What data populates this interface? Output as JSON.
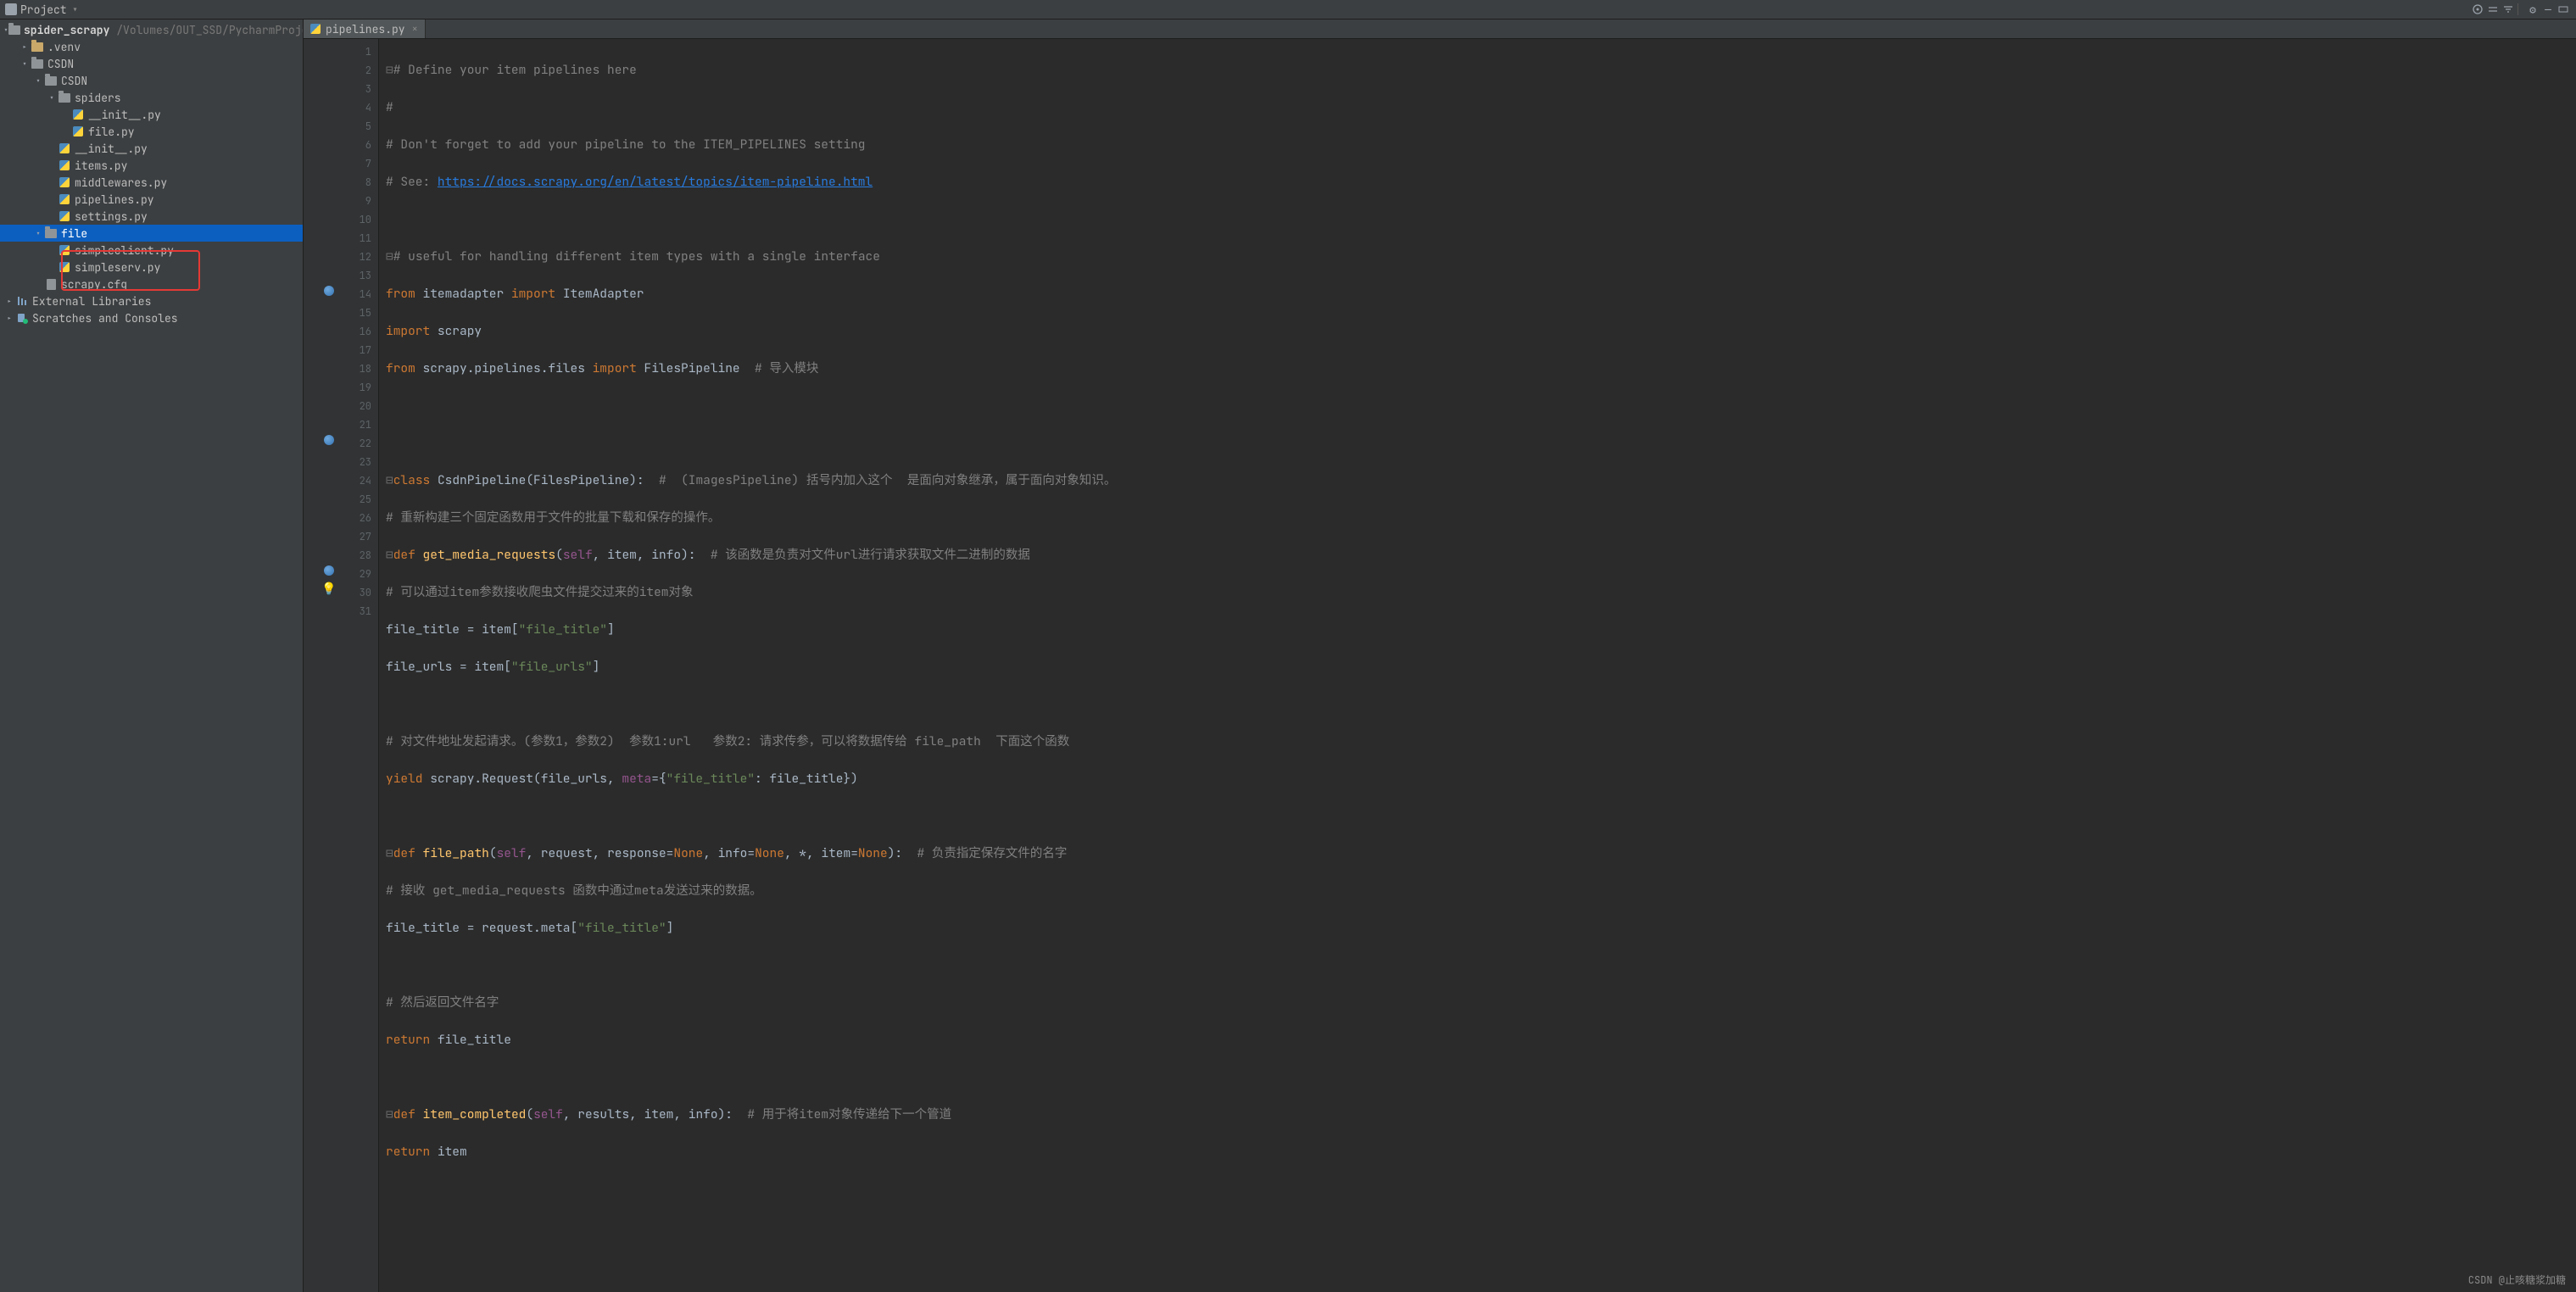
{
  "toolbar": {
    "title": "Project"
  },
  "tab": {
    "filename": "pipelines.py"
  },
  "tree": {
    "root": {
      "name": "spider_scrapy",
      "path": "/Volumes/OUT_SSD/PycharmProje"
    },
    "items": [
      {
        "lvl": 1,
        "chev": ">",
        "ico": "dir-open",
        "label": ".venv"
      },
      {
        "lvl": 1,
        "chev": "v",
        "ico": "dir",
        "label": "CSDN"
      },
      {
        "lvl": 2,
        "chev": "v",
        "ico": "dir",
        "label": "CSDN"
      },
      {
        "lvl": 3,
        "chev": "v",
        "ico": "dir",
        "label": "spiders"
      },
      {
        "lvl": 4,
        "chev": "",
        "ico": "py",
        "label": "__init__.py"
      },
      {
        "lvl": 4,
        "chev": "",
        "ico": "py",
        "label": "file.py"
      },
      {
        "lvl": 3,
        "chev": "",
        "ico": "py",
        "label": "__init__.py"
      },
      {
        "lvl": 3,
        "chev": "",
        "ico": "py",
        "label": "items.py"
      },
      {
        "lvl": 3,
        "chev": "",
        "ico": "py",
        "label": "middlewares.py"
      },
      {
        "lvl": 3,
        "chev": "",
        "ico": "py",
        "label": "pipelines.py"
      },
      {
        "lvl": 3,
        "chev": "",
        "ico": "py",
        "label": "settings.py"
      },
      {
        "lvl": 2,
        "chev": "v",
        "ico": "dir",
        "label": "file",
        "sel": true
      },
      {
        "lvl": 3,
        "chev": "",
        "ico": "py",
        "label": "simpleclient.py"
      },
      {
        "lvl": 3,
        "chev": "",
        "ico": "py",
        "label": "simpleserv.py"
      },
      {
        "lvl": 2,
        "chev": "",
        "ico": "file",
        "label": "scrapy.cfg"
      }
    ],
    "extlib": "External Libraries",
    "scratches": "Scratches and Consoles"
  },
  "code": {
    "l1a": "# Define your item pipelines here",
    "l2": "#",
    "l3": "# Don't forget to add your pipeline to the ITEM_PIPELINES setting",
    "l4a": "# See: ",
    "l4b": "https://docs.scrapy.org/en/latest/topics/item-pipeline.html",
    "l6": "# useful for handling different item types with a single interface",
    "l7a": "from ",
    "l7b": "itemadapter ",
    "l7c": "import ",
    "l7d": "ItemAdapter",
    "l8a": "import ",
    "l8b": "scrapy",
    "l9a": "from ",
    "l9b": "scrapy.pipelines.files ",
    "l9c": "import ",
    "l9d": "FilesPipeline  ",
    "l9e": "# 导入模块",
    "l12a": "class ",
    "l12b": "CsdnPipeline",
    "l12c": "(FilesPipeline):  ",
    "l12d": "#  (ImagesPipeline) 括号内加入这个  是面向对象继承，属于面向对象知识。",
    "l13": "# 重新构建三个固定函数用于文件的批量下载和保存的操作。",
    "l14a": "def ",
    "l14b": "get_media_requests",
    "l14c": "(",
    "l14d": "self",
    "l14e": ", item, info):  ",
    "l14f": "# 该函数是负责对文件url进行请求获取文件二进制的数据",
    "l15": "# 可以通过item参数接收爬虫文件提交过来的item对象",
    "l16a": "file_title = item[",
    "l16b": "\"file_title\"",
    "l16c": "]",
    "l17a": "file_urls = item[",
    "l17b": "\"file_urls\"",
    "l17c": "]",
    "l19": "# 对文件地址发起请求。(参数1，参数2)  参数1:url   参数2: 请求传参，可以将数据传给 file_path  下面这个函数",
    "l20a": "yield ",
    "l20b": "scrapy.Request(file_urls, ",
    "l20c": "meta",
    "l20d": "={",
    "l20e": "\"file_title\"",
    "l20f": ": file_title})",
    "l22a": "def ",
    "l22b": "file_path",
    "l22c": "(",
    "l22d": "self",
    "l22e": ", request, response=",
    "l22f": "None",
    "l22g": ", info=",
    "l22h": "None",
    "l22i": ", *, item=",
    "l22j": "None",
    "l22k": "):  ",
    "l22l": "# 负责指定保存文件的名字",
    "l23": "# 接收 get_media_requests 函数中通过meta发送过来的数据。",
    "l24a": "file_title = request.meta[",
    "l24b": "\"file_title\"",
    "l24c": "]",
    "l26": "# 然后返回文件名字",
    "l27a": "return ",
    "l27b": "file_title",
    "l29a": "def ",
    "l29b": "item_completed",
    "l29c": "(",
    "l29d": "self",
    "l29e": ", results, item, info):  ",
    "l29f": "# 用于将item对象传递给下一个管道",
    "l30a": "return ",
    "l30b": "item"
  },
  "linenumbers": [
    "1",
    "2",
    "3",
    "4",
    "5",
    "6",
    "7",
    "8",
    "9",
    "10",
    "11",
    "12",
    "13",
    "14",
    "15",
    "16",
    "17",
    "18",
    "19",
    "20",
    "21",
    "22",
    "23",
    "24",
    "25",
    "26",
    "27",
    "28",
    "29",
    "30",
    "31"
  ],
  "watermark": "CSDN @止咳糖浆加糖"
}
